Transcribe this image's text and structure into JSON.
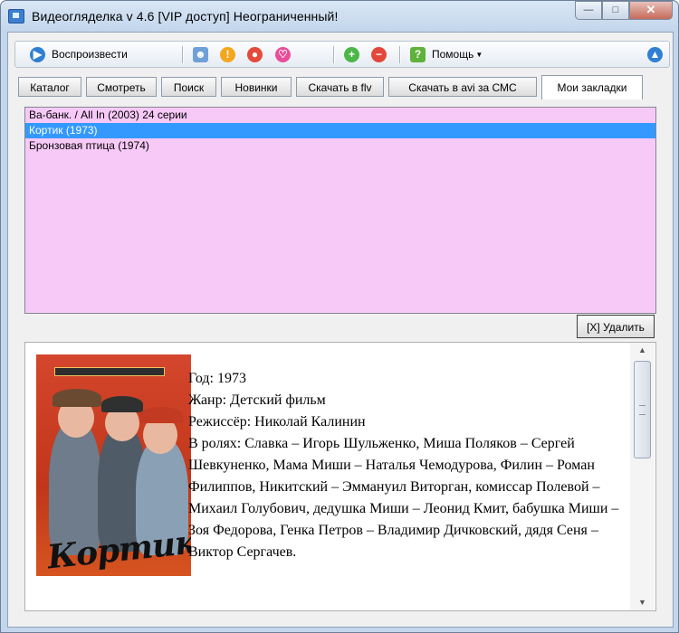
{
  "window": {
    "title": "Видеогляделка v 4.6 [VIP доступ] Неограниченный!"
  },
  "toolbar": {
    "play_label": "Воспроизвести",
    "help_label": "Помощь",
    "icons": [
      "play-icon",
      "user-icon",
      "warning-icon",
      "record-icon",
      "heart-icon",
      "add-icon",
      "remove-icon",
      "help-icon",
      "up-icon"
    ]
  },
  "tabs": [
    {
      "label": "Каталог"
    },
    {
      "label": "Смотреть"
    },
    {
      "label": "Поиск"
    },
    {
      "label": "Новинки"
    },
    {
      "label": "Скачать в flv"
    },
    {
      "label": "Скачать в avi за СМС"
    },
    {
      "label": "Мои закладки",
      "active": true
    }
  ],
  "bookmarks": [
    {
      "title": "Ва-банк. / All In (2003) 24 серии"
    },
    {
      "title": "Кортик (1973)",
      "selected": true
    },
    {
      "title": "Бронзовая птица (1974)"
    }
  ],
  "delete_label": "[X] Удалить",
  "details": {
    "poster_title": "Кортик",
    "year": "Год: 1973",
    "genre": "Жанр: Детский фильм",
    "director": "Режиссёр: Николай Калинин",
    "cast": "В ролях: Славка – Игорь Шульженко, Миша Поляков – Сергей Шевкуненко, Мама Миши – Наталья Чемодурова, Филин – Роман Филиппов, Никитский – Эммануил Виторган, комиссар Полевой – Михаил Голубович, дедушка Миши – Леонид Кмит, бабушка Миши – Зоя Федорова, Генка Петров – Владимир Дичковский, дядя Сеня – Виктор Сергачев."
  },
  "colors": {
    "list_background": "#f7c9f7",
    "selection": "#3399ff"
  }
}
